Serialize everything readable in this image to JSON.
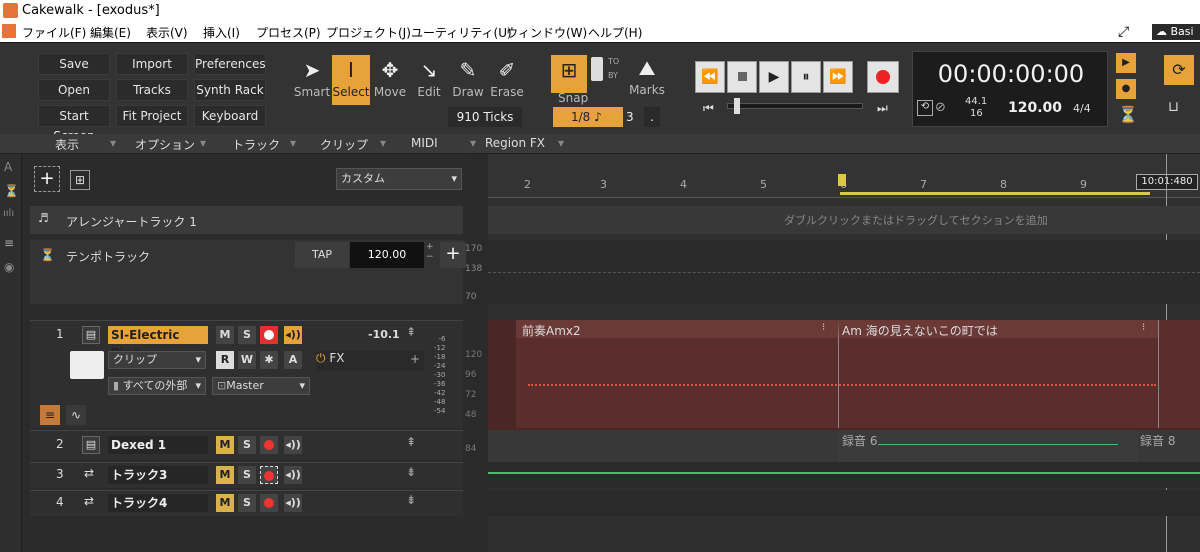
{
  "window": {
    "title": "Cakewalk - [exodus*]",
    "badge": "Basi"
  },
  "menu": [
    "ファイル(F)",
    "編集(E)",
    "表示(V)",
    "挿入(I)",
    "プロセス(P)",
    "プロジェクト(J)",
    "ユーティリティ(U)",
    "ウィンドウ(W)",
    "ヘルプ(H)"
  ],
  "quick": [
    [
      "Save",
      "Import",
      "Preferences"
    ],
    [
      "Open",
      "Tracks",
      "Synth Rack"
    ],
    [
      "Start Screen",
      "Fit Project",
      "Keyboard"
    ]
  ],
  "tools": {
    "smart": "Smart",
    "select": "Select",
    "move": "Move",
    "edit": "Edit",
    "draw": "Draw",
    "erase": "Erase",
    "ticks": "910 Ticks"
  },
  "snap": {
    "label": "Snap",
    "to": "TO",
    "by": "BY",
    "value": "1/8",
    "note": "♪",
    "count": "3",
    "dot": ".",
    "marks": "Marks"
  },
  "transport": {
    "time": "00:00:00:00",
    "sr_top": "44.1",
    "sr_bottom": "16",
    "tempo": "120.00",
    "meter": "4/4"
  },
  "viewbar": [
    "表示",
    "オプション",
    "トラック",
    "クリップ",
    "MIDI",
    "Region FX"
  ],
  "track_header": {
    "preset": "カスタム"
  },
  "arranger": {
    "name": "アレンジャートラック 1",
    "hint": "ダブルクリックまたはドラッグしてセクションを追加"
  },
  "tempo_track": {
    "name": "テンポトラック",
    "tap": "TAP",
    "value": "120.00",
    "scale": [
      "170",
      "138",
      "70"
    ]
  },
  "ruler": {
    "marks": [
      "2",
      "3",
      "4",
      "5",
      "6",
      "7",
      "8",
      "9"
    ],
    "now": "10:01:480"
  },
  "tracks": [
    {
      "num": "1",
      "name": "SI-Electric Pian",
      "m": "M",
      "s": "S",
      "vol": "-10.1",
      "clip": "クリップ",
      "r": "R",
      "w": "W",
      "a": "A",
      "fx": "FX",
      "input": "すべての外部",
      "output": "Master",
      "meter": [
        "-6",
        "-12",
        "-18",
        "-24",
        "-30",
        "-36",
        "-42",
        "-48",
        "-54"
      ],
      "keys": [
        "120",
        "96",
        "72",
        "48",
        "84"
      ]
    },
    {
      "num": "2",
      "name": "Dexed 1",
      "m": "M",
      "s": "S"
    },
    {
      "num": "3",
      "name": "トラック3",
      "m": "M",
      "s": "S"
    },
    {
      "num": "4",
      "name": "トラック4",
      "m": "M",
      "s": "S"
    }
  ],
  "clips": {
    "c1": "前奏Amx2",
    "c2": "Am 海の見えないこの町では",
    "c3": "録音 6",
    "c4": "録音 8"
  },
  "colors": {
    "accent": "#e8a23a",
    "clip_red": "#5a2e2c",
    "note": "#d05a40",
    "green": "#3fbf6a"
  }
}
